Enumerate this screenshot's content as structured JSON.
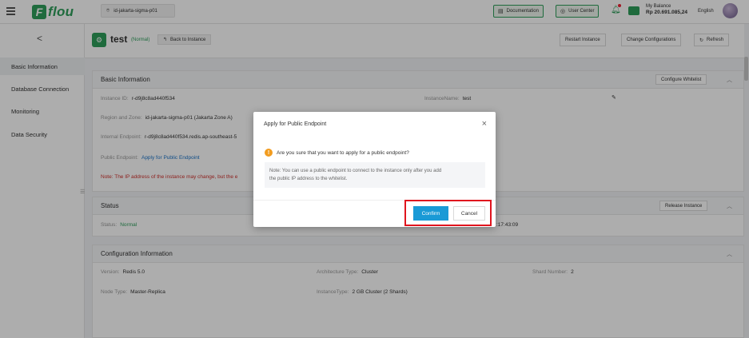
{
  "topbar": {
    "logo_mark": "F",
    "logo_text": "flou",
    "region": "id-jakarta-sigma-p01",
    "documentation": "Documentation",
    "user_center": "User Center",
    "balance_label": "My Balance",
    "balance_amount": "Rp 20.691.085,24",
    "language": "English"
  },
  "sidebar": {
    "back": "<",
    "items": [
      {
        "label": "Basic Information"
      },
      {
        "label": "Database Connection"
      },
      {
        "label": "Monitoring"
      },
      {
        "label": "Data Security"
      }
    ]
  },
  "instance": {
    "name": "test",
    "status": "(Normal)",
    "back_to_instance": "Back to Instance",
    "restart": "Restart Instance",
    "change_config": "Change Configurations",
    "refresh": "Refresh"
  },
  "basic_info": {
    "title": "Basic Information",
    "configure_whitelist": "Configure Whitelist",
    "instance_id_label": "Instance ID:",
    "instance_id": "r-d9j8c8ad440f534",
    "instance_name_label": "InstanceName:",
    "instance_name": "test",
    "region_label": "Region and Zone:",
    "region": "id-jakarta-sigma-p01 (Jakarta Zone A)",
    "internal_label": "Internal Endpoint:",
    "internal": "r-d9j8c8ad440f534.redis.ap-southeast-5",
    "public_label": "Public Endpoint:",
    "public_link": "Apply for Public Endpoint",
    "note": "Note:  The IP address of the instance may change, but the e"
  },
  "status_panel": {
    "title": "Status",
    "release": "Release Instance",
    "status_label": "Status:",
    "status_value": "Normal",
    "time_fragment": ":17:43:09"
  },
  "config_panel": {
    "title": "Configuration Information",
    "version_label": "Version:",
    "version": "Redis 5.0",
    "arch_label": "Architecture Type:",
    "arch": "Cluster",
    "shard_label": "Shard Number:",
    "shard": "2",
    "node_label": "Node Type:",
    "node": "Master-Replica",
    "type_label": "InstanceType:",
    "type": "2 GB Cluster (2 Shards)"
  },
  "modal": {
    "title": "Apply for Public Endpoint",
    "question": "Are you sure that you want to apply for a public endpoint?",
    "note_line1": "Note: You can use a public endpoint to connect to the instance only after you add",
    "note_line2": "the public IP address to the whitelist.",
    "confirm": "Confirm",
    "cancel": "Cancel"
  },
  "icons": {
    "warning": "!",
    "close": "×"
  },
  "colors": {
    "brand_green": "#2e9e5b",
    "confirm_blue": "#1a9ad6",
    "highlight_red": "#e0141e"
  }
}
